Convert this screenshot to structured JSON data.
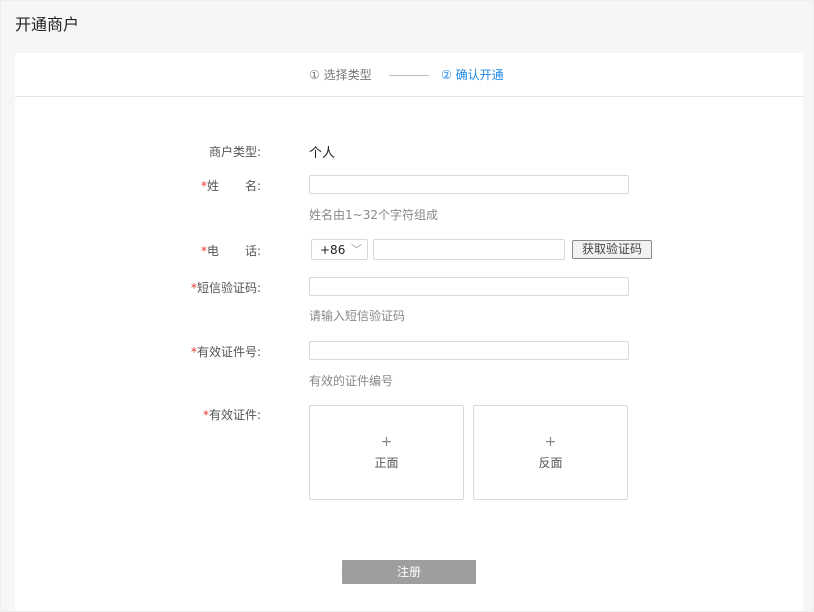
{
  "page": {
    "title": "开通商户"
  },
  "steps": {
    "step1": "① 选择类型",
    "step2": "② 确认开通"
  },
  "form": {
    "merchant_type": {
      "label": "商户类型:",
      "value": "个人"
    },
    "name": {
      "star": "*",
      "label_a": "姓",
      "label_b": "名:",
      "hint": "姓名由1~32个字符组成",
      "value": ""
    },
    "phone": {
      "star": "*",
      "label_a": "电",
      "label_b": "话:",
      "country_code": "+86",
      "value": "",
      "code_button": "获取验证码"
    },
    "sms_code": {
      "star": "*",
      "label": "短信验证码:",
      "hint": "请输入短信验证码",
      "value": ""
    },
    "id_number": {
      "star": "*",
      "label": "有效证件号:",
      "hint": "有效的证件编号",
      "value": ""
    },
    "id_document": {
      "star": "*",
      "label": "有效证件:",
      "front": {
        "icon": "+",
        "label": "正面"
      },
      "back": {
        "icon": "+",
        "label": "反面"
      }
    }
  },
  "submit_label": "注册",
  "colors": {
    "accent": "#1e88e5",
    "required": "#e53935",
    "submit_bg": "#9e9e9e"
  }
}
